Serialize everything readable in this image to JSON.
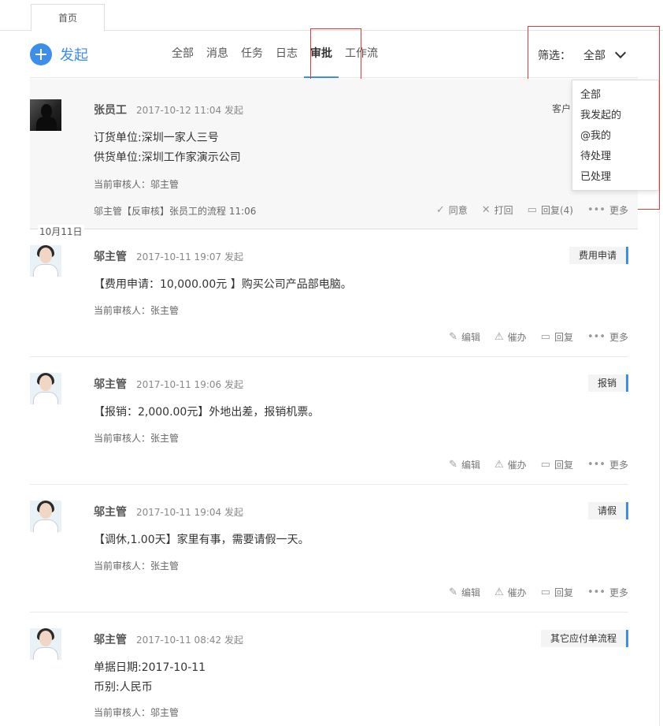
{
  "tabs": {
    "home": "首页"
  },
  "toolbar": {
    "create_label": "发起",
    "nav": [
      "全部",
      "消息",
      "任务",
      "日志",
      "审批",
      "工作流"
    ],
    "active_nav": "审批"
  },
  "filter": {
    "label": "筛选：",
    "value": "全部",
    "options": [
      "全部",
      "我发起的",
      "@我的",
      "待处理",
      "已处理"
    ]
  },
  "date_separator": "10月11日",
  "cards": [
    {
      "name": "张员工",
      "time": "2017-10-12 11:04 发起",
      "tag": "客户",
      "lines": [
        "订货单位:深圳一家人三号",
        "供货单位:深圳工作家演示公司"
      ],
      "reviewer": "当前审核人：邬主管",
      "trail": "邬主管【反审核】张员工的流程   11:06",
      "actions": [
        "同意",
        "打回",
        "回复(4)",
        "更多"
      ]
    },
    {
      "name": "邬主管",
      "time": "2017-10-11 19:07 发起",
      "tag": "费用申请",
      "lines": [
        "【费用申请：10,000.00元 】购买公司产品部电脑。"
      ],
      "reviewer": "当前审核人：张主管",
      "actions": [
        "编辑",
        "催办",
        "回复",
        "更多"
      ]
    },
    {
      "name": "邬主管",
      "time": "2017-10-11 19:06 发起",
      "tag": "报销",
      "lines": [
        "【报销：2,000.00元】外地出差，报销机票。"
      ],
      "reviewer": "当前审核人：张主管",
      "actions": [
        "编辑",
        "催办",
        "回复",
        "更多"
      ]
    },
    {
      "name": "邬主管",
      "time": "2017-10-11 19:04 发起",
      "tag": "请假",
      "lines": [
        "【调休,1.00天】家里有事，需要请假一天。"
      ],
      "reviewer": "当前审核人：张主管",
      "actions": [
        "编辑",
        "催办",
        "回复",
        "更多"
      ]
    },
    {
      "name": "邬主管",
      "time": "2017-10-11 08:42 发起",
      "tag": "其它应付单流程",
      "lines": [
        "单据日期:2017-10-11",
        "币别:人民币"
      ],
      "reviewer": "当前审核人：邬主管"
    }
  ],
  "colors": {
    "accent": "#3d8eea",
    "highlight": "#e03a3a"
  }
}
